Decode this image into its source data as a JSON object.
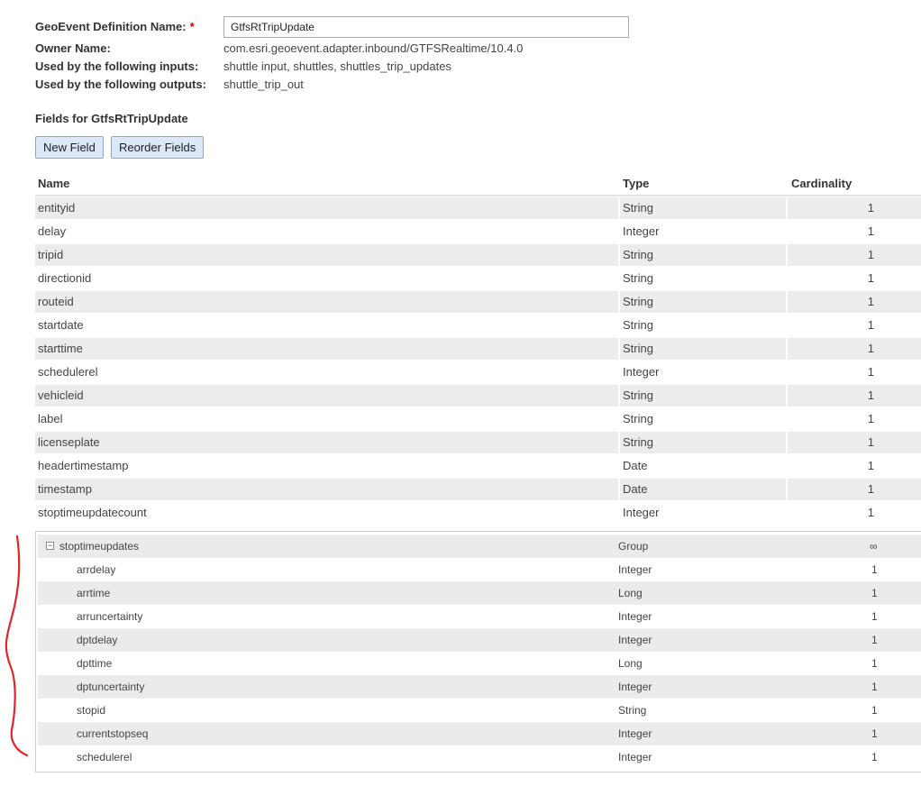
{
  "form": {
    "def_label": "GeoEvent Definition Name:",
    "required_marker": "*",
    "def_value": "GtfsRtTripUpdate",
    "owner_label": "Owner Name:",
    "owner_value": "com.esri.geoevent.adapter.inbound/GTFSRealtime/10.4.0",
    "inputs_label": "Used by the following inputs:",
    "inputs_value": "shuttle input, shuttles, shuttles_trip_updates",
    "outputs_label": "Used by the following outputs:",
    "outputs_value": "shuttle_trip_out"
  },
  "fields_title": "Fields for GtfsRtTripUpdate",
  "toolbar": {
    "new_field": "New Field",
    "reorder_fields": "Reorder Fields"
  },
  "columns": {
    "name": "Name",
    "type": "Type",
    "cardinality": "Cardinality"
  },
  "rows": [
    {
      "name": "entityid",
      "type": "String",
      "card": "1"
    },
    {
      "name": "delay",
      "type": "Integer",
      "card": "1"
    },
    {
      "name": "tripid",
      "type": "String",
      "card": "1"
    },
    {
      "name": "directionid",
      "type": "String",
      "card": "1"
    },
    {
      "name": "routeid",
      "type": "String",
      "card": "1"
    },
    {
      "name": "startdate",
      "type": "String",
      "card": "1"
    },
    {
      "name": "starttime",
      "type": "String",
      "card": "1"
    },
    {
      "name": "schedulerel",
      "type": "Integer",
      "card": "1"
    },
    {
      "name": "vehicleid",
      "type": "String",
      "card": "1"
    },
    {
      "name": "label",
      "type": "String",
      "card": "1"
    },
    {
      "name": "licenseplate",
      "type": "String",
      "card": "1"
    },
    {
      "name": "headertimestamp",
      "type": "Date",
      "card": "1"
    },
    {
      "name": "timestamp",
      "type": "Date",
      "card": "1"
    },
    {
      "name": "stoptimeupdatecount",
      "type": "Integer",
      "card": "1"
    }
  ],
  "group": {
    "toggle_glyph": "−",
    "name": "stoptimeupdates",
    "type": "Group",
    "card": "∞",
    "children": [
      {
        "name": "arrdelay",
        "type": "Integer",
        "card": "1"
      },
      {
        "name": "arrtime",
        "type": "Long",
        "card": "1"
      },
      {
        "name": "arruncertainty",
        "type": "Integer",
        "card": "1"
      },
      {
        "name": "dptdelay",
        "type": "Integer",
        "card": "1"
      },
      {
        "name": "dpttime",
        "type": "Long",
        "card": "1"
      },
      {
        "name": "dptuncertainty",
        "type": "Integer",
        "card": "1"
      },
      {
        "name": "stopid",
        "type": "String",
        "card": "1"
      },
      {
        "name": "currentstopseq",
        "type": "Integer",
        "card": "1"
      },
      {
        "name": "schedulerel",
        "type": "Integer",
        "card": "1"
      }
    ]
  },
  "colors": {
    "button_bg": "#dbe8f7",
    "row_shade": "#ececec",
    "required": "#cc0000",
    "annotation": "#e0252b"
  }
}
